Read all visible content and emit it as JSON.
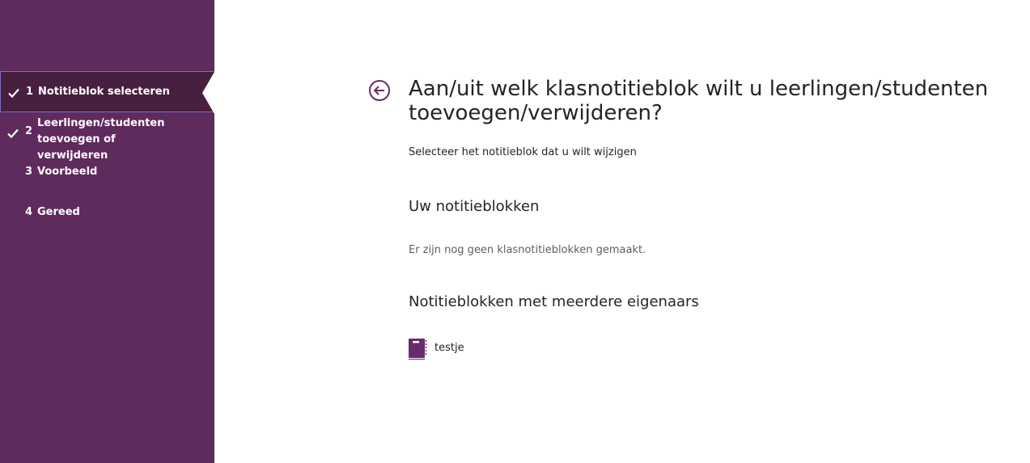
{
  "colors": {
    "sidebar_bg": "#5f2a5c",
    "active_step_bg": "#47203f",
    "accent": "#6b2a6b"
  },
  "sidebar": {
    "steps": [
      {
        "number": "1",
        "label": "Notitieblok selecteren",
        "completed": true,
        "active": true
      },
      {
        "number": "2",
        "label": "Leerlingen/studenten toevoegen of verwijderen",
        "completed": true,
        "active": false
      },
      {
        "number": "3",
        "label": "Voorbeeld",
        "completed": false,
        "active": false
      },
      {
        "number": "4",
        "label": "Gereed",
        "completed": false,
        "active": false
      }
    ]
  },
  "main": {
    "back_icon": "arrow-left-circle-icon",
    "title": "Aan/uit welk klasnotitieblok wilt u leerlingen/studenten toevoegen/verwijderen?",
    "subtitle": "Selecteer het notitieblok dat u wilt wijzigen",
    "own_section": {
      "heading": "Uw notitieblokken",
      "empty_message": "Er zijn nog geen klasnotitieblokken gemaakt."
    },
    "shared_section": {
      "heading": "Notitieblokken met meerdere eigenaars",
      "items": [
        {
          "icon": "notebook-icon",
          "label": "testje"
        }
      ]
    }
  }
}
